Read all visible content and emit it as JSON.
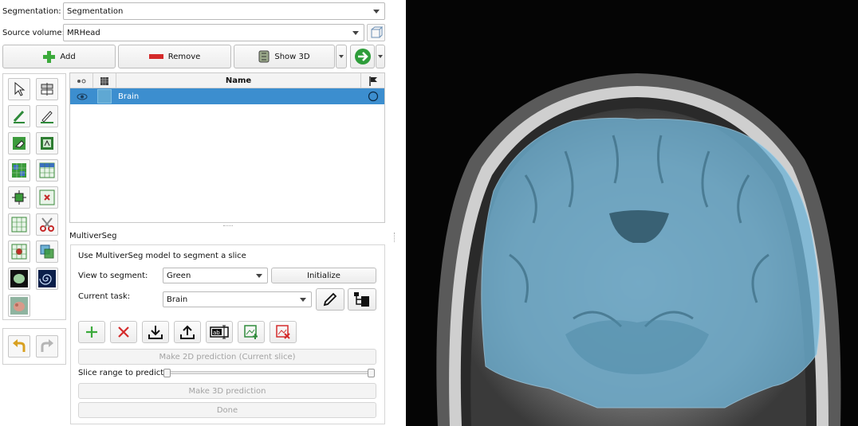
{
  "segmentation": {
    "label": "Segmentation:",
    "value": "Segmentation"
  },
  "source_volume": {
    "label": "Source volume:",
    "value": "MRHead"
  },
  "actions": {
    "add": "Add",
    "remove": "Remove",
    "show3d": "Show 3D"
  },
  "segments_table": {
    "columns": [
      "Name"
    ],
    "rows": [
      {
        "name": "Brain",
        "color": "#5fa8d3"
      }
    ]
  },
  "panel": {
    "title": "MultiverSeg",
    "description": "Use MultiverSeg model to segment a slice",
    "view_label": "View to segment:",
    "view_value": "Green",
    "initialize": "Initialize",
    "task_label": "Current task:",
    "task_value": "Brain",
    "make2d": "Make 2D prediction (Current slice)",
    "slice_range_label": "Slice range to predict:",
    "slice_range": [
      0,
      1
    ],
    "make3d": "Make 3D prediction",
    "done": "Done"
  },
  "colors": {
    "accent": "#3c8ecf",
    "overlay": "#6fb3d6",
    "add_green": "#3caa3c",
    "remove_red": "#d42a2a"
  }
}
